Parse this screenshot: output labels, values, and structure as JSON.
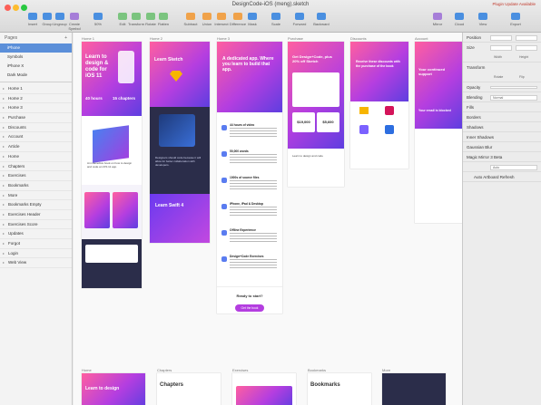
{
  "window": {
    "title": "DesignCode-iOS (meng).sketch",
    "update_notice": "Plugin Update Available"
  },
  "toolbar": {
    "items": [
      {
        "label": "Insert",
        "icon": "plus-icon"
      },
      {
        "label": "Group",
        "icon": "group-icon"
      },
      {
        "label": "Ungroup",
        "icon": "ungroup-icon"
      },
      {
        "label": "Create Symbol",
        "icon": "symbol-icon"
      },
      {
        "label": "50%",
        "icon": "zoom-icon"
      },
      {
        "label": "Edit",
        "icon": "edit-icon"
      },
      {
        "label": "Transform",
        "icon": "transform-icon"
      },
      {
        "label": "Rotate",
        "icon": "rotate-icon"
      },
      {
        "label": "Flatten",
        "icon": "flatten-icon"
      },
      {
        "label": "Subtract",
        "icon": "subtract-icon"
      },
      {
        "label": "Union",
        "icon": "union-icon"
      },
      {
        "label": "Intersect",
        "icon": "intersect-icon"
      },
      {
        "label": "Difference",
        "icon": "difference-icon"
      },
      {
        "label": "Mask",
        "icon": "mask-icon"
      },
      {
        "label": "Scale",
        "icon": "scale-icon"
      },
      {
        "label": "Forward",
        "icon": "forward-icon"
      },
      {
        "label": "Backward",
        "icon": "backward-icon"
      },
      {
        "label": "Mirror",
        "icon": "mirror-icon"
      },
      {
        "label": "Cloud",
        "icon": "cloud-icon"
      },
      {
        "label": "View",
        "icon": "view-icon"
      },
      {
        "label": "Export",
        "icon": "export-icon"
      }
    ]
  },
  "sidebar": {
    "pages_title": "Pages",
    "pages": [
      "iPhone",
      "Symbols",
      "iPhone X",
      "Dark Mode"
    ],
    "selected_page": "iPhone",
    "layers": [
      "Home 1",
      "Home 2",
      "Home 3",
      "Purchase",
      "Discounts",
      "Account",
      "Article",
      "Home",
      "Chapters",
      "Exercises",
      "Bookmarks",
      "More",
      "Bookmarks Empty",
      "Exercises Header",
      "Exercises Score",
      "Updates",
      "Forgot",
      "Login",
      "Web View"
    ]
  },
  "canvas": {
    "artboards": [
      {
        "name": "Home 1",
        "heading": "Learn to design & code for iOS 11",
        "stat1": "40 hours",
        "stat2": "15 chapters",
        "caption": "An interactive book on how to design and code an iOS 11 app."
      },
      {
        "name": "Home 2",
        "heading": "Learn Sketch",
        "caption": "Designers should code because it will allow for better collaboration with developers.",
        "heading2": "Learn Swift 4"
      },
      {
        "name": "Home 3",
        "heading": "A dedicated app. Where you learn to build that app.",
        "features": [
          {
            "title": "44 hours of video"
          },
          {
            "title": "50,000 words"
          },
          {
            "title": "1000s of source files"
          },
          {
            "title": "iPhone, iPad & Desktop"
          },
          {
            "title": "Offline Experience"
          },
          {
            "title": "Design+Code Exercises"
          }
        ],
        "cta_title": "Ready to start?",
        "cta_button": "Get the book"
      },
      {
        "name": "Purchase",
        "promo": "Get Design+Code, plus 20% off Sketch",
        "price1": "$19,000",
        "price2": "$5,600",
        "note": "Learn to design and code"
      },
      {
        "name": "Discounts",
        "promo": "Receive these discounts with the purchase of the book"
      },
      {
        "name": "Account",
        "heading": "Your continued support",
        "caption": "Your email is blocked"
      }
    ],
    "row2": [
      "Home",
      "Chapters",
      "Exercises",
      "Bookmarks",
      "More"
    ],
    "row2_titles": {
      "home": "Learn to design",
      "chapters": "Chapters",
      "bookmarks": "Bookmarks"
    }
  },
  "inspector": {
    "sections": [
      "Position",
      "Size",
      "Transform",
      "Opacity",
      "Blending",
      "Fills",
      "Borders",
      "Shadows",
      "Inner Shadows",
      "Gaussian Blur",
      "Magic Mirror 3 Beta"
    ],
    "blending_value": "Normal",
    "auto_label": "Auto",
    "auto_artboard": "Auto Artboard Refresh",
    "labels": {
      "width": "Width",
      "height": "Height",
      "rotate": "Rotate",
      "flip": "Flip"
    }
  },
  "colors": {
    "accent": "#5b8fd9",
    "brand_pink": "#ff5fa0",
    "brand_purple": "#b43ee0"
  }
}
